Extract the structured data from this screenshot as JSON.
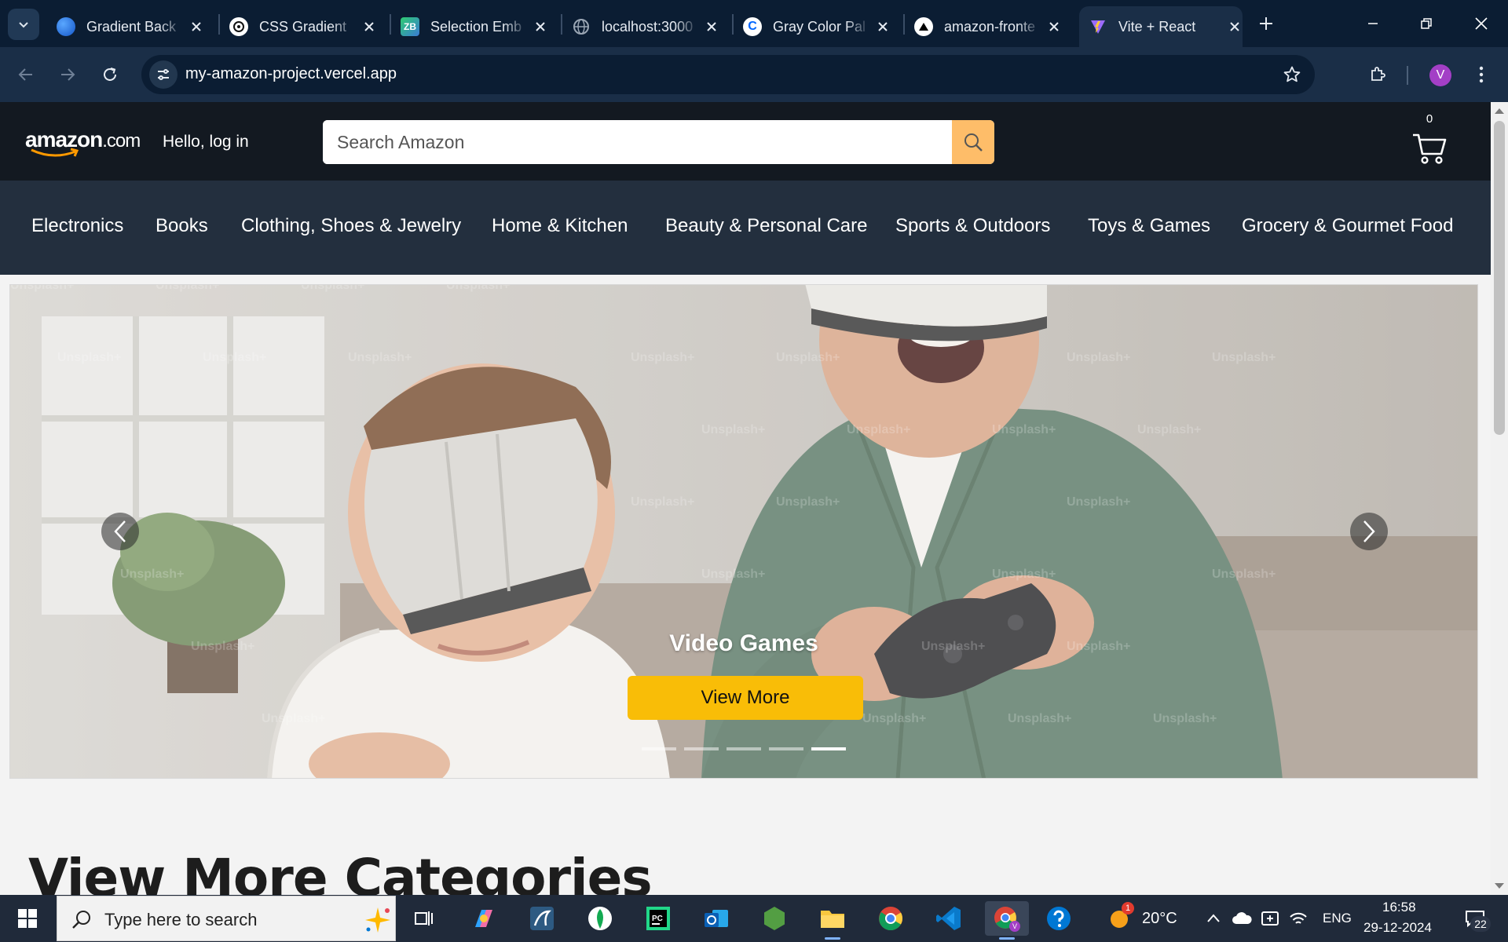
{
  "browser": {
    "tabs": [
      {
        "title": "Gradient Back",
        "icon": "gradient-favicon",
        "active": false
      },
      {
        "title": "CSS Gradient",
        "icon": "openai-favicon",
        "active": false
      },
      {
        "title": "Selection Emb",
        "icon": "zb-favicon",
        "active": false
      },
      {
        "title": "localhost:3000",
        "icon": "globe-favicon",
        "active": false
      },
      {
        "title": "Gray Color Pal",
        "icon": "coolors-favicon",
        "active": false
      },
      {
        "title": "amazon-fronte",
        "icon": "vercel-favicon",
        "active": false
      },
      {
        "title": "Vite + React",
        "icon": "vite-favicon",
        "active": true
      }
    ],
    "url": "my-amazon-project.vercel.app",
    "profile_initial": "V"
  },
  "header": {
    "logo_main": "amazon",
    "logo_suffix": ".com",
    "greeting": "Hello, log in",
    "search_placeholder": "Search Amazon",
    "cart_count": "0"
  },
  "nav": {
    "items": [
      "Electronics",
      "Books",
      "Clothing, Shoes & Jewelry",
      "Home & Kitchen",
      "Beauty & Personal Care",
      "Sports & Outdoors",
      "Toys & Games",
      "Grocery & Gourmet Food"
    ]
  },
  "carousel": {
    "caption": "Video Games",
    "button_label": "View More",
    "watermark": "Unsplash+",
    "slide_count": 5,
    "active_slide": 5
  },
  "sections": {
    "more_categories_title": "View More Categories"
  },
  "taskbar": {
    "search_placeholder": "Type here to search",
    "weather": "20°C",
    "weather_badge": "1",
    "language": "ENG",
    "time": "16:58",
    "date": "29-12-2024",
    "notification_count": "22"
  }
}
